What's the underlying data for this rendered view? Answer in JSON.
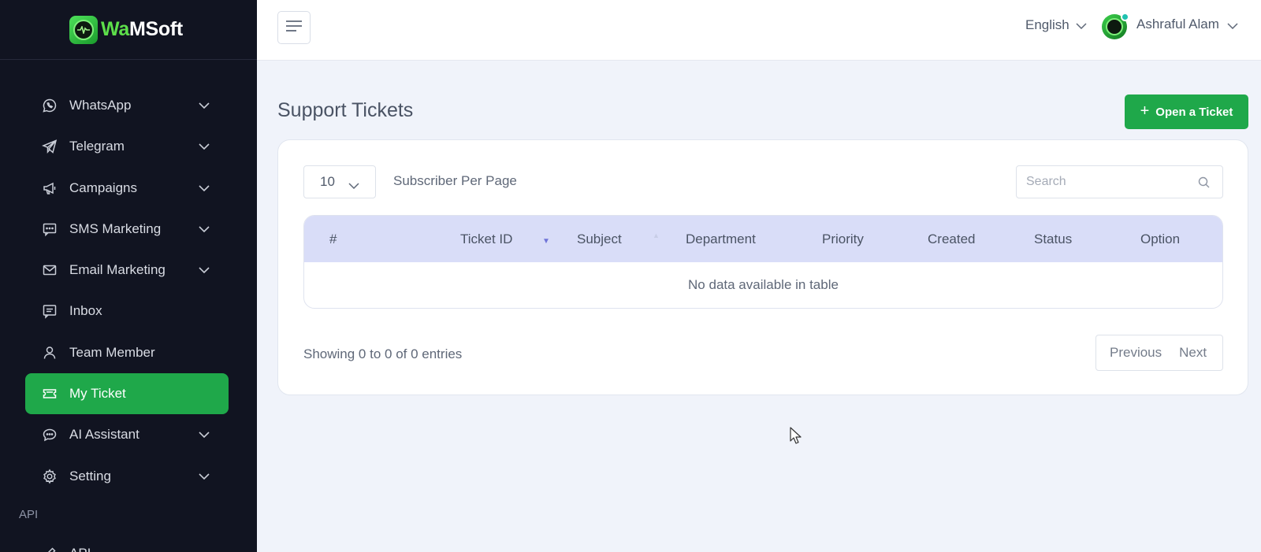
{
  "brand": {
    "name_part1": "Wa",
    "name_part2": "MSoft"
  },
  "sidebar": {
    "items": [
      {
        "label": "WhatsApp",
        "icon": "whatsapp-icon",
        "has_submenu": true
      },
      {
        "label": "Telegram",
        "icon": "telegram-icon",
        "has_submenu": true
      },
      {
        "label": "Campaigns",
        "icon": "megaphone-icon",
        "has_submenu": true
      },
      {
        "label": "SMS Marketing",
        "icon": "sms-icon",
        "has_submenu": true
      },
      {
        "label": "Email Marketing",
        "icon": "envelope-icon",
        "has_submenu": true
      },
      {
        "label": "Inbox",
        "icon": "inbox-icon",
        "has_submenu": false
      },
      {
        "label": "Team Member",
        "icon": "user-icon",
        "has_submenu": false
      },
      {
        "label": "My Ticket",
        "icon": "ticket-icon",
        "has_submenu": false,
        "active": true
      },
      {
        "label": "AI Assistant",
        "icon": "chat-icon",
        "has_submenu": true
      },
      {
        "label": "Setting",
        "icon": "gear-icon",
        "has_submenu": true
      }
    ],
    "section_label": "API",
    "api_item": {
      "label": "API",
      "icon": "pen-icon"
    }
  },
  "topbar": {
    "language": "English",
    "user_name": "Ashraful Alam"
  },
  "page": {
    "title": "Support Tickets",
    "open_ticket_label": "Open a Ticket"
  },
  "table_controls": {
    "per_page_value": "10",
    "per_page_label": "Subscriber Per Page",
    "search_placeholder": "Search"
  },
  "table": {
    "columns": [
      "#",
      "Ticket ID",
      "Subject",
      "Department",
      "Priority",
      "Created",
      "Status",
      "Option"
    ],
    "empty_message": "No data available in table"
  },
  "footer": {
    "showing": "Showing 0 to 0 of 0 entries",
    "previous": "Previous",
    "next": "Next"
  },
  "colors": {
    "sidebar_bg": "#111421",
    "accent_green": "#1fa84a",
    "table_header_bg": "#d9ddf8",
    "page_bg": "#f0f3fa"
  }
}
